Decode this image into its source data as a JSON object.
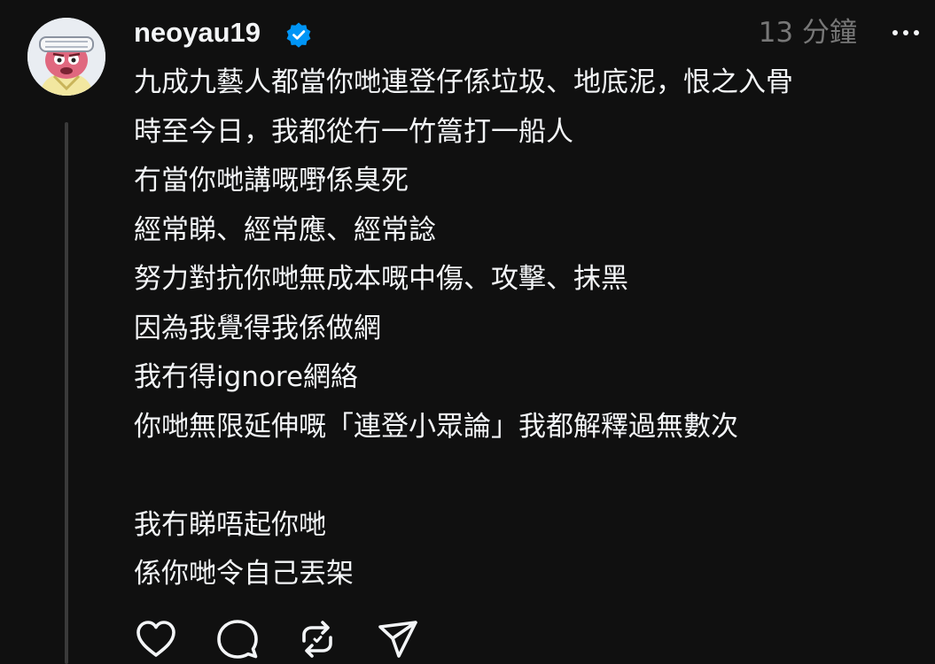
{
  "post": {
    "username": "neoyau19",
    "verified": true,
    "timestamp": "13 分鐘",
    "lines": [
      "九成九藝人都當你哋連登仔係垃圾、地底泥，恨之入骨",
      "時至今日，我都從冇一竹篙打一船人",
      "冇當你哋講嘅嘢係臭死",
      "經常睇、經常應、經常諗",
      "努力對抗你哋無成本嘅中傷、攻擊、抹黑",
      "因為我覺得我係做網",
      "我冇得ignore網絡",
      "你哋無限延伸嘅「連登小眾論」我都解釋過無數次",
      "",
      "我冇睇唔起你哋",
      "係你哋令自己丟架"
    ]
  },
  "actions": [
    {
      "name": "like-button",
      "icon": "heart-icon"
    },
    {
      "name": "reply-button",
      "icon": "comment-icon"
    },
    {
      "name": "repost-button",
      "icon": "repost-icon"
    },
    {
      "name": "share-button",
      "icon": "send-icon"
    }
  ],
  "colors": {
    "background": "#101010",
    "text": "#f3f5f7",
    "muted": "#777777",
    "verified": "#0095f6",
    "thread_line": "#3a3a3a"
  }
}
